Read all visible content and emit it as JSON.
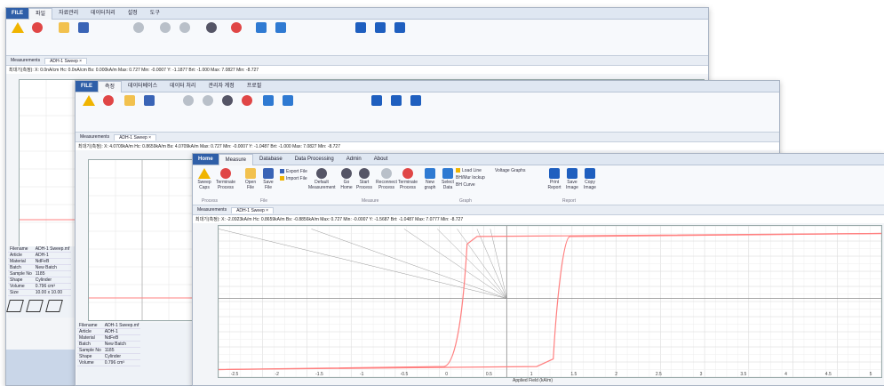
{
  "windows": {
    "back": {
      "tabs": [
        "파일",
        "측정",
        "자료관리",
        "데이터처리",
        "설정",
        "도구"
      ],
      "doc_tabs": [
        "Measurements",
        "ADH-1 Sweep ×"
      ],
      "info_line": "최대기(측정): X: 0.0nA/cm  Hc: 0.0nA/cm  Bs: 0.000kA/m  Max: 0.727  Min: -0.0007  Y: -1.1877  Brt: -1.000  Max: 7.0827  Min: -8.727",
      "sample": {
        "rows": [
          [
            "Filename",
            "ADH-1 Sweep.mf"
          ],
          [
            "Article",
            "ADH-1"
          ],
          [
            "Material",
            "NdFeB"
          ],
          [
            "Batch",
            "New Batch"
          ],
          [
            "Sample No",
            "1185"
          ],
          [
            "Shape",
            "Cylinder"
          ],
          [
            "Volume",
            "0.796 cm³"
          ],
          [
            "Size",
            "10.00 x 10.00"
          ]
        ]
      }
    },
    "middle": {
      "tabs": [
        "파일",
        "측정",
        "데이터베이스",
        "데이터 처리",
        "관리자 계정",
        "프로필"
      ],
      "doc_tabs": [
        "Measurements",
        "ADH-1 Sweep ×"
      ],
      "info_line": "최대기(측정): X: 4.0709kA/m  Hc: 0.8659kA/m  Bs: 4.0709kA/m  Max: 0.727  Min: -0.0007  Y: -1.0487  Brt: -1.000  Max: 7.0827  Min: -8.727",
      "sample": {
        "rows": [
          [
            "Filename",
            "ADH-1 Sweep.mf"
          ],
          [
            "Article",
            "ADH-1"
          ],
          [
            "Material",
            "NdFeB"
          ],
          [
            "Batch",
            "New Batch"
          ],
          [
            "Sample No",
            "1185"
          ],
          [
            "Shape",
            "Cylinder"
          ],
          [
            "Volume",
            "0.796 cm³"
          ]
        ]
      }
    },
    "front": {
      "file_tab": "Home",
      "tabs": [
        "Measure",
        "Database",
        "Data Processing",
        "Admin",
        "About"
      ],
      "ribbon": {
        "buttons": [
          {
            "label": "Sweep Caps",
            "icon": "warning-icon"
          },
          {
            "label": "Terminate Process",
            "icon": "stop-icon"
          },
          {
            "label": "Open File",
            "icon": "folder-icon"
          },
          {
            "label": "Save File",
            "icon": "disk-icon"
          },
          {
            "label": "Default Measurement",
            "icon": "gear-icon"
          },
          {
            "label": "Go Home",
            "icon": "home-icon"
          },
          {
            "label": "Start Process",
            "icon": "play-icon"
          },
          {
            "label": "Reconnect Process",
            "icon": "reconnect-icon"
          },
          {
            "label": "Terminate Process",
            "icon": "stop-icon"
          },
          {
            "label": "New graph",
            "icon": "graph-icon"
          },
          {
            "label": "Select Data",
            "icon": "table-icon"
          },
          {
            "label": "Print Report",
            "icon": "print-icon"
          },
          {
            "label": "Save Image",
            "icon": "image-icon"
          },
          {
            "label": "Copy Image",
            "icon": "copy-icon"
          }
        ],
        "small_items": [
          "Export File",
          "Import File",
          "Load Line",
          "BH/Mur lockup",
          "BH Curve",
          "Voltage Graphs"
        ],
        "groups": [
          "Process",
          "File",
          "Measure",
          "Graph",
          "Report"
        ]
      },
      "doc_tabs": [
        "Measurements",
        "ADH-1 Sweep ×"
      ],
      "info_line": "최대기(측정): X: -2.0923kA/m  Hc: 0.8659kA/m  Bs: -0.8856kA/m  Max: 0.727  Min: -0.0007  Y: -1.5687  Brt: -1.0487  Max: 7.0777  Min: -8.727",
      "x_label": "Applied Field (kA/m)",
      "x_ticks": [
        "-2.5",
        "-2",
        "-1.5",
        "-1",
        "-0.5",
        "0",
        "0.5",
        "1",
        "1.5",
        "2",
        "2.5",
        "3",
        "3.5",
        "4",
        "4.5",
        "5"
      ]
    }
  },
  "colors": {
    "curve": "#ff8080",
    "accent": "#2f5fa8"
  }
}
